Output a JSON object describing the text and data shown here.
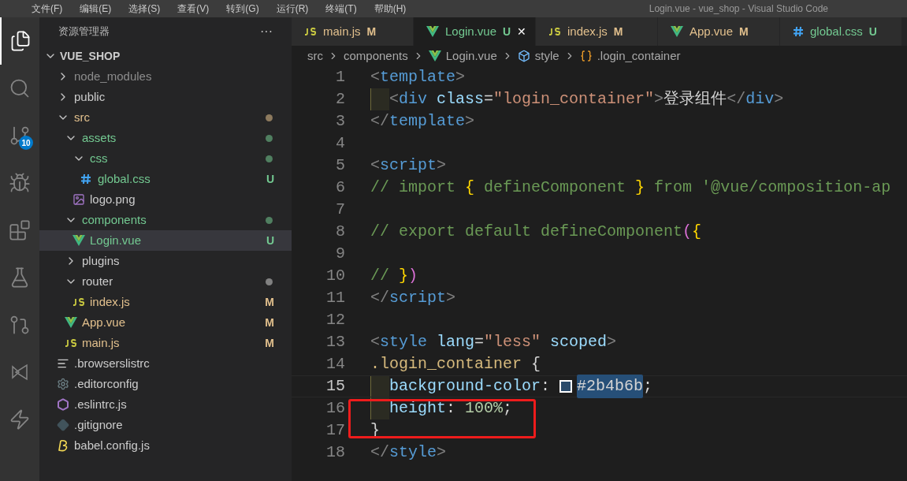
{
  "menu_bar": {
    "items": [
      "文件(F)",
      "编辑(E)",
      "选择(S)",
      "查看(V)",
      "转到(G)",
      "运行(R)",
      "终端(T)",
      "帮助(H)"
    ],
    "title": "Login.vue - vue_shop - Visual Studio Code"
  },
  "activity_bar": [
    {
      "kind": "explorer",
      "selected": true
    },
    {
      "kind": "search",
      "selected": false
    },
    {
      "kind": "source-control",
      "selected": false,
      "badge": "10"
    },
    {
      "kind": "run",
      "selected": false
    },
    {
      "kind": "extensions",
      "selected": false
    },
    {
      "kind": "testing",
      "selected": false
    },
    {
      "kind": "remote",
      "selected": false
    },
    {
      "kind": "liveshare",
      "selected": false
    },
    {
      "kind": "lightning",
      "selected": false
    }
  ],
  "sidebar": {
    "title": "资源管理器",
    "more": "···",
    "root": "VUE_SHOP",
    "items": [
      {
        "name": "node_modules",
        "kind": "folder",
        "expanded": false,
        "color": "#8c8c8c"
      },
      {
        "name": "public",
        "kind": "folder",
        "expanded": false,
        "color": "#cccccc"
      },
      {
        "name": "src",
        "kind": "folder",
        "expanded": true,
        "color": "#e2c08d",
        "dot": true,
        "children": [
          {
            "name": "assets",
            "kind": "folder",
            "expanded": true,
            "color": "#73c991",
            "dot": true,
            "children": [
              {
                "name": "css",
                "kind": "folder",
                "expanded": true,
                "color": "#73c991",
                "dot": true,
                "children": [
                  {
                    "name": "global.css",
                    "kind": "css",
                    "color": "#73c991",
                    "badge": "U"
                  }
                ]
              },
              {
                "name": "logo.png",
                "kind": "image",
                "color": "#cccccc"
              }
            ]
          },
          {
            "name": "components",
            "kind": "folder",
            "expanded": true,
            "color": "#73c991",
            "dot": true,
            "children": [
              {
                "name": "Login.vue",
                "kind": "vue",
                "color": "#73c991",
                "badge": "U",
                "selected": true
              }
            ]
          },
          {
            "name": "plugins",
            "kind": "folder",
            "expanded": false,
            "color": "#cccccc"
          },
          {
            "name": "router",
            "kind": "folder",
            "expanded": true,
            "color": "#cccccc",
            "dot": true,
            "children": [
              {
                "name": "index.js",
                "kind": "js",
                "color": "#e2c08d",
                "badge": "M"
              }
            ]
          },
          {
            "name": "App.vue",
            "kind": "vue",
            "color": "#e2c08d",
            "badge": "M"
          },
          {
            "name": "main.js",
            "kind": "js",
            "color": "#e2c08d",
            "badge": "M"
          }
        ]
      },
      {
        "name": ".browserslistrc",
        "kind": "lines",
        "color": "#cccccc"
      },
      {
        "name": ".editorconfig",
        "kind": "gear",
        "color": "#cccccc"
      },
      {
        "name": ".eslintrc.js",
        "kind": "eslint",
        "color": "#cccccc"
      },
      {
        "name": ".gitignore",
        "kind": "git",
        "color": "#cccccc"
      },
      {
        "name": "babel.config.js",
        "kind": "babel",
        "color": "#cccccc"
      }
    ]
  },
  "tabs": [
    {
      "label": "main.js",
      "kind": "js",
      "badge": "M",
      "color": "#e2c08d",
      "selected": false
    },
    {
      "label": "Login.vue",
      "kind": "vue",
      "badge": "U",
      "color": "#73c991",
      "selected": true,
      "close": "✕"
    },
    {
      "label": "index.js",
      "kind": "js",
      "badge": "M",
      "color": "#e2c08d",
      "selected": false
    },
    {
      "label": "App.vue",
      "kind": "vue",
      "badge": "M",
      "color": "#e2c08d",
      "selected": false
    },
    {
      "label": "global.css",
      "kind": "css",
      "badge": "U",
      "color": "#73c991",
      "selected": false
    }
  ],
  "breadcrumb": [
    {
      "label": "src",
      "kind": "folder"
    },
    {
      "label": "components",
      "kind": "folder"
    },
    {
      "label": "Login.vue",
      "kind": "vue"
    },
    {
      "label": "style",
      "kind": "element"
    },
    {
      "label": ".login_container",
      "kind": "selector"
    }
  ],
  "code": [
    {
      "number": "1",
      "tokens": [
        {
          "text": "<",
          "kind": "punct"
        },
        {
          "text": "template",
          "kind": "tag"
        },
        {
          "text": ">",
          "kind": "punct"
        }
      ]
    },
    {
      "number": "2",
      "indented": true,
      "tokens": [
        {
          "text": "<",
          "kind": "punct"
        },
        {
          "text": "div",
          "kind": "tag"
        },
        {
          "text": " class",
          "kind": "attr"
        },
        {
          "text": "=",
          "kind": "plain"
        },
        {
          "text": "\"login_container\"",
          "kind": "string"
        },
        {
          "text": ">",
          "kind": "punct"
        },
        {
          "text": "登录组件",
          "kind": "plain"
        },
        {
          "text": "</",
          "kind": "punct"
        },
        {
          "text": "div",
          "kind": "tag"
        },
        {
          "text": ">",
          "kind": "punct"
        }
      ]
    },
    {
      "number": "3",
      "tokens": [
        {
          "text": "</",
          "kind": "punct"
        },
        {
          "text": "template",
          "kind": "tag"
        },
        {
          "text": ">",
          "kind": "punct"
        }
      ]
    },
    {
      "number": "4"
    },
    {
      "number": "5",
      "tokens": [
        {
          "text": "<",
          "kind": "punct"
        },
        {
          "text": "script",
          "kind": "tag"
        },
        {
          "text": ">",
          "kind": "punct"
        }
      ]
    },
    {
      "number": "6",
      "tokens": [
        {
          "text": "// import ",
          "kind": "comment"
        },
        {
          "text": "{",
          "kind": "brace"
        },
        {
          "text": " defineComponent ",
          "kind": "comment"
        },
        {
          "text": "}",
          "kind": "brace"
        },
        {
          "text": " from '@vue/composition-ap",
          "kind": "comment"
        }
      ]
    },
    {
      "number": "7"
    },
    {
      "number": "8",
      "tokens": [
        {
          "text": "// export default defineComponent",
          "kind": "comment"
        },
        {
          "text": "(",
          "kind": "paren"
        },
        {
          "text": "{",
          "kind": "brace"
        }
      ]
    },
    {
      "number": "9"
    },
    {
      "number": "10",
      "tokens": [
        {
          "text": "// ",
          "kind": "comment"
        },
        {
          "text": "}",
          "kind": "brace"
        },
        {
          "text": ")",
          "kind": "paren"
        }
      ]
    },
    {
      "number": "11",
      "tokens": [
        {
          "text": "</",
          "kind": "punct"
        },
        {
          "text": "script",
          "kind": "tag"
        },
        {
          "text": ">",
          "kind": "punct"
        }
      ]
    },
    {
      "number": "12"
    },
    {
      "number": "13",
      "tokens": [
        {
          "text": "<",
          "kind": "punct"
        },
        {
          "text": "style",
          "kind": "tag"
        },
        {
          "text": " lang",
          "kind": "attr"
        },
        {
          "text": "=",
          "kind": "plain"
        },
        {
          "text": "\"less\"",
          "kind": "string"
        },
        {
          "text": " scoped",
          "kind": "attr"
        },
        {
          "text": ">",
          "kind": "punct"
        }
      ]
    },
    {
      "number": "14",
      "tokens": [
        {
          "text": ".login_container",
          "kind": "selector"
        },
        {
          "text": " {",
          "kind": "plain"
        }
      ]
    },
    {
      "number": "15",
      "indented": true,
      "active": true,
      "tokens": [
        {
          "text": "background-color",
          "kind": "attr"
        },
        {
          "text": ": ",
          "kind": "plain"
        },
        {
          "text": "#2b4b6b",
          "kind": "swatch",
          "color": "#2b4b6b"
        },
        {
          "text": ";",
          "kind": "plain"
        }
      ]
    },
    {
      "number": "16",
      "indented": true,
      "boxed": true,
      "tokens": [
        {
          "text": "height",
          "kind": "attr"
        },
        {
          "text": ": ",
          "kind": "plain"
        },
        {
          "text": "100%",
          "kind": "number"
        },
        {
          "text": ";",
          "kind": "plain"
        }
      ]
    },
    {
      "number": "17",
      "boxed": true,
      "tokens": [
        {
          "text": "}",
          "kind": "plain"
        }
      ]
    },
    {
      "number": "18",
      "tokens": [
        {
          "text": "</",
          "kind": "punct"
        },
        {
          "text": "style",
          "kind": "tag"
        },
        {
          "text": ">",
          "kind": "punct"
        }
      ]
    }
  ]
}
